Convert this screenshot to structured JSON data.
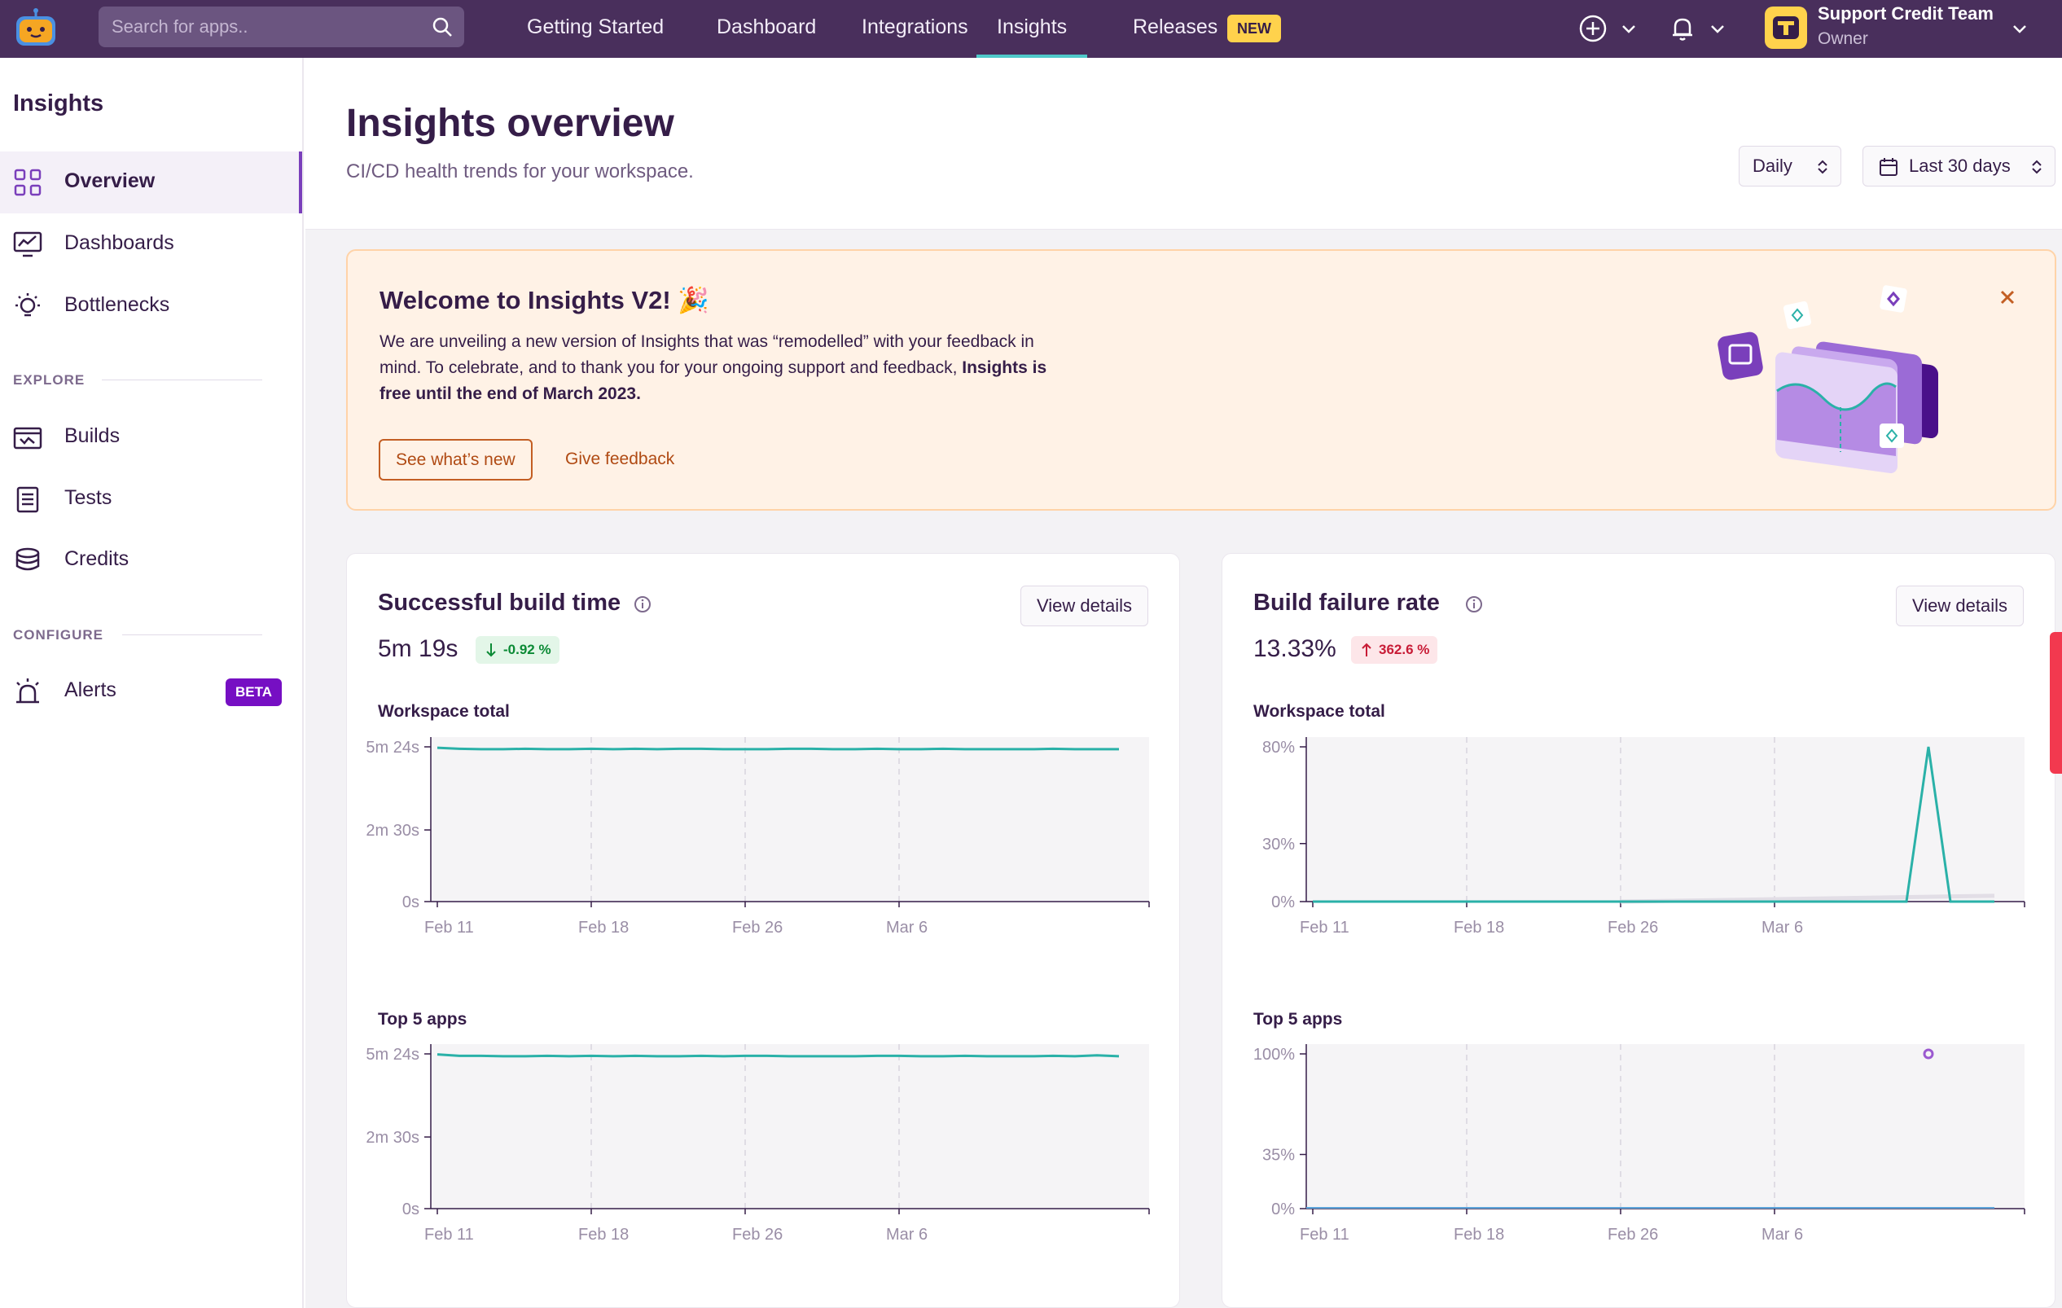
{
  "topbar": {
    "search_placeholder": "Search for apps..",
    "nav": [
      {
        "label": "Getting Started"
      },
      {
        "label": "Dashboard"
      },
      {
        "label": "Integrations"
      },
      {
        "label": "Insights"
      },
      {
        "label": "Releases"
      }
    ],
    "new_badge": "NEW",
    "account": {
      "name": "Support Credit Team",
      "role": "Owner"
    },
    "colors": {
      "bar": "#492f5c",
      "active_underline": "#4fc9c9",
      "badge": "#ffd24c"
    }
  },
  "sidebar": {
    "title": "Insights",
    "items": [
      {
        "label": "Overview",
        "icon": "grid-icon"
      },
      {
        "label": "Dashboards",
        "icon": "monitor-chart-icon"
      },
      {
        "label": "Bottlenecks",
        "icon": "lightbulb-icon"
      }
    ],
    "explore_label": "EXPLORE",
    "explore_items": [
      {
        "label": "Builds",
        "icon": "builds-icon"
      },
      {
        "label": "Tests",
        "icon": "clipboard-icon"
      },
      {
        "label": "Credits",
        "icon": "coin-stack-icon"
      }
    ],
    "configure_label": "CONFIGURE",
    "configure_items": [
      {
        "label": "Alerts",
        "icon": "siren-icon",
        "badge": "BETA"
      }
    ]
  },
  "header": {
    "title": "Insights overview",
    "subtitle": "CI/CD health trends for your workspace.",
    "granularity": "Daily",
    "range": "Last 30 days"
  },
  "banner": {
    "title": "Welcome to Insights V2! 🎉",
    "body_1": "We are unveiling a new version of Insights that was “remodelled” with your feedback in mind. To celebrate, and to thank you for your ongoing support and feedback, ",
    "body_bold": "Insights is free until the end of March 2023.",
    "primary_button": "See what’s new",
    "secondary_link": "Give feedback"
  },
  "cards": [
    {
      "title": "Successful build time",
      "view_button": "View details",
      "value": "5m 19s",
      "delta": "-0.92 %",
      "delta_direction": "down",
      "section_workspace": "Workspace total",
      "section_top": "Top 5 apps"
    },
    {
      "title": "Build failure rate",
      "view_button": "View details",
      "value": "13.33%",
      "delta": "362.6 %",
      "delta_direction": "up",
      "section_workspace": "Workspace total",
      "section_top": "Top 5 apps"
    }
  ],
  "chart_data": [
    {
      "type": "line",
      "x": [
        "Feb 11",
        "Feb 18",
        "Feb 26",
        "Mar 6"
      ],
      "y_ticks": [
        "5m 24s",
        "2m 30s",
        "0s"
      ],
      "ylim_seconds": [
        0,
        324
      ],
      "series": [
        {
          "values_seconds": [
            322,
            320,
            319,
            319,
            320,
            319,
            319,
            320,
            319,
            320,
            319,
            320,
            320,
            319,
            319,
            319,
            320,
            320,
            319,
            319,
            320,
            319,
            319,
            320,
            319,
            319,
            319,
            319,
            320,
            319,
            319,
            319
          ]
        }
      ],
      "color": "#2ab1a8"
    },
    {
      "type": "line",
      "x": [
        "Feb 11",
        "Feb 18",
        "Feb 26",
        "Mar 6"
      ],
      "y_ticks": [
        "5m 24s",
        "2m 30s",
        "0s"
      ],
      "ylim_seconds": [
        0,
        324
      ],
      "series": [
        {
          "values_seconds": [
            323,
            320,
            320,
            319,
            319,
            320,
            319,
            320,
            319,
            320,
            319,
            319,
            320,
            319,
            320,
            320,
            319,
            319,
            319,
            319,
            320,
            320,
            319,
            319,
            320,
            319,
            319,
            319,
            320,
            319,
            321,
            319
          ]
        }
      ],
      "color": "#2ab1a8"
    },
    {
      "type": "line",
      "x": [
        "Feb 11",
        "Feb 18",
        "Feb 26",
        "Mar 6"
      ],
      "y_ticks": [
        "80%",
        "30%",
        "0%"
      ],
      "ylim": [
        0,
        80
      ],
      "series": [
        {
          "values": [
            0,
            0,
            0,
            0,
            0,
            0,
            0,
            0,
            0,
            0,
            0,
            0,
            0,
            0,
            0,
            0,
            0,
            0,
            0,
            0,
            0,
            0,
            0,
            0,
            0,
            0,
            0,
            0,
            80,
            0,
            0,
            0
          ]
        }
      ],
      "trend_end": 10,
      "color": "#2ab1a8"
    },
    {
      "type": "scatter",
      "x": [
        "Feb 11",
        "Feb 18",
        "Feb 26",
        "Mar 6"
      ],
      "y_ticks": [
        "100%",
        "35%",
        "0%"
      ],
      "ylim": [
        0,
        100
      ],
      "point": {
        "index": 28,
        "value": 100
      },
      "color": "#9b59d0"
    }
  ]
}
